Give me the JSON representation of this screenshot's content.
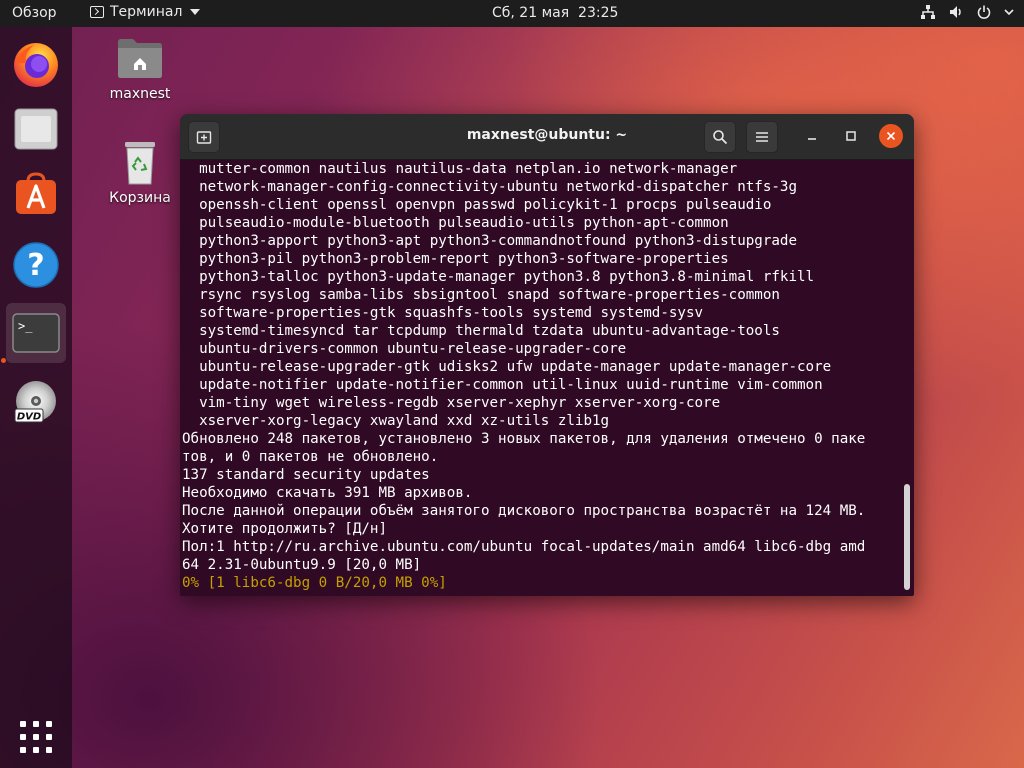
{
  "topbar": {
    "activities": "Обзор",
    "app_name": "Терминал",
    "clock": "Сб, 21 мая  23:25",
    "icons": [
      "network-icon",
      "volume-icon",
      "power-icon",
      "chevron-down-icon"
    ]
  },
  "dock": {
    "items": [
      {
        "name": "firefox",
        "icon": "firefox-icon"
      },
      {
        "name": "files",
        "icon": "files-icon"
      },
      {
        "name": "software",
        "icon": "software-store-icon"
      },
      {
        "name": "help",
        "icon": "help-icon"
      },
      {
        "name": "terminal",
        "icon": "terminal-icon",
        "active": true
      },
      {
        "name": "dvd",
        "icon": "dvd-icon"
      },
      {
        "name": "show-applications",
        "icon": "app-grid-icon"
      }
    ],
    "help_glyph": "?",
    "terminal_glyph": ">_",
    "dvd_label": "DVD"
  },
  "desktop": {
    "home_label": "maxnest",
    "trash_label": "Корзина"
  },
  "terminal": {
    "title": "maxnest@ubuntu: ~",
    "lines": [
      "  mutter-common nautilus nautilus-data netplan.io network-manager",
      "  network-manager-config-connectivity-ubuntu networkd-dispatcher ntfs-3g",
      "  openssh-client openssl openvpn passwd policykit-1 procps pulseaudio",
      "  pulseaudio-module-bluetooth pulseaudio-utils python-apt-common",
      "  python3-apport python3-apt python3-commandnotfound python3-distupgrade",
      "  python3-pil python3-problem-report python3-software-properties",
      "  python3-talloc python3-update-manager python3.8 python3.8-minimal rfkill",
      "  rsync rsyslog samba-libs sbsigntool snapd software-properties-common",
      "  software-properties-gtk squashfs-tools systemd systemd-sysv",
      "  systemd-timesyncd tar tcpdump thermald tzdata ubuntu-advantage-tools",
      "  ubuntu-drivers-common ubuntu-release-upgrader-core",
      "  ubuntu-release-upgrader-gtk udisks2 ufw update-manager update-manager-core",
      "  update-notifier update-notifier-common util-linux uuid-runtime vim-common",
      "  vim-tiny wget wireless-regdb xserver-xephyr xserver-xorg-core",
      "  xserver-xorg-legacy xwayland xxd xz-utils zlib1g",
      "Обновлено 248 пакетов, установлено 3 новых пакетов, для удаления отмечено 0 паке",
      "тов, и 0 пакетов не обновлено.",
      "137 standard security updates",
      "Необходимо скачать 391 MB архивов.",
      "После данной операции объём занятого дискового пространства возрастёт на 124 MB.",
      "Хотите продолжить? [Д/н]",
      "Пол:1 http://ru.archive.ubuntu.com/ubuntu focal-updates/main amd64 libc6-dbg amd",
      "64 2.31-0ubuntu9.9 [20,0 MB]"
    ],
    "progress_line": "0% [1 libc6-dbg 0 B/20,0 MB 0%]"
  },
  "colors": {
    "accent": "#e95420",
    "terminal_bg": "#300a24",
    "progress_text": "#c4a000"
  }
}
